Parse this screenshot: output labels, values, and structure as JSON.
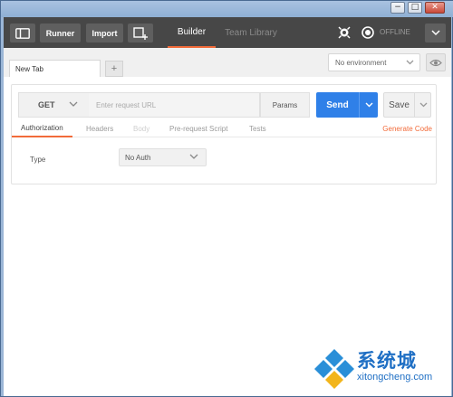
{
  "window": {
    "minimize": "−",
    "maximize": "□",
    "close": "✕"
  },
  "topbar": {
    "runner": "Runner",
    "import": "Import",
    "tabs": [
      "Builder",
      "Team Library"
    ],
    "offline": "OFFLINE"
  },
  "request_tab": {
    "label": "New Tab",
    "add": "+"
  },
  "environment": {
    "selected": "No environment"
  },
  "request": {
    "method": "GET",
    "url_placeholder": "Enter request URL",
    "params": "Params",
    "send": "Send",
    "save": "Save"
  },
  "subtabs": [
    "Authorization",
    "Headers",
    "Body",
    "Pre-request Script",
    "Tests"
  ],
  "generate_code": "Generate Code",
  "auth": {
    "type_label": "Type",
    "selected": "No Auth"
  },
  "watermark": {
    "text": "系统城",
    "url": "xitongcheng.com"
  },
  "colors": {
    "accent": "#f26b3a",
    "send": "#2f80e8",
    "topbar": "#474747"
  }
}
